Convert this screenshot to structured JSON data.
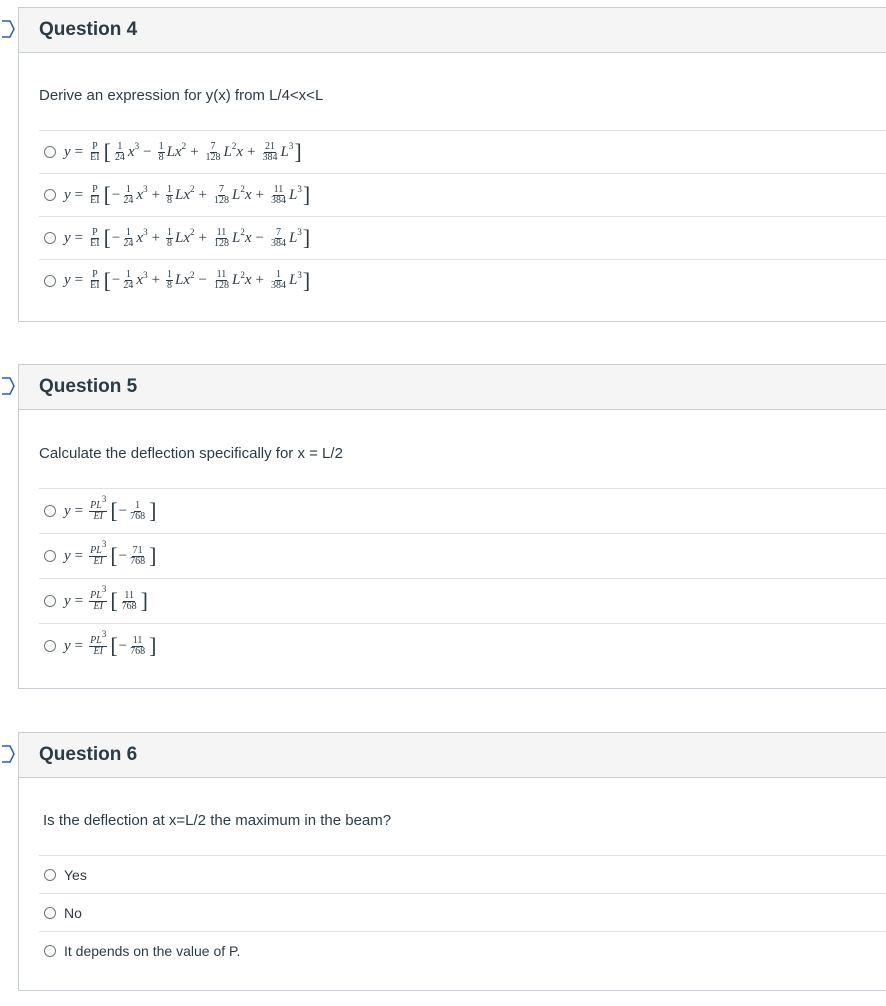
{
  "questions": [
    {
      "title": "Question 4",
      "text": "Derive an expression for y(x) from L/4<x<L",
      "answers": [
        {
          "a": "1",
          "b": "24",
          "s1": "−",
          "c": "1",
          "d": "8",
          "s2": "+",
          "e": "7",
          "f": "128",
          "s3": "+",
          "g": "21",
          "h": "384",
          "lead": ""
        },
        {
          "a": "1",
          "b": "24",
          "s1": "+",
          "c": "1",
          "d": "8",
          "s2": "+",
          "e": "7",
          "f": "128",
          "s3": "+",
          "g": "11",
          "h": "384",
          "lead": "−"
        },
        {
          "a": "1",
          "b": "24",
          "s1": "+",
          "c": "1",
          "d": "8",
          "s2": "+",
          "e": "11",
          "f": "128",
          "s3": "−",
          "g": "7",
          "h": "384",
          "lead": "−"
        },
        {
          "a": "1",
          "b": "24",
          "s1": "+",
          "c": "1",
          "d": "8",
          "s2": "−",
          "e": "11",
          "f": "128",
          "s3": "+",
          "g": "1",
          "h": "384",
          "lead": "−"
        }
      ]
    },
    {
      "title": "Question 5",
      "text": "Calculate the deflection specifically for x = L/2",
      "answers": [
        {
          "lead": "−",
          "num": "1",
          "den": "768"
        },
        {
          "lead": "−",
          "num": "71",
          "den": "768"
        },
        {
          "lead": "",
          "num": "11",
          "den": "768"
        },
        {
          "lead": "−",
          "num": "11",
          "den": "768"
        }
      ]
    },
    {
      "title": "Question 6",
      "text": "Is the deflection at x=L/2 the maximum in the beam?",
      "answers": [
        "Yes",
        "No",
        "It depends on the value of P."
      ]
    }
  ],
  "math": {
    "y": "y",
    "eq": "=",
    "P": "P",
    "EI": "EI",
    "PL": "PL",
    "three": "3",
    "two": "2",
    "x": "x",
    "L": "L",
    "Lx": "Lx"
  }
}
